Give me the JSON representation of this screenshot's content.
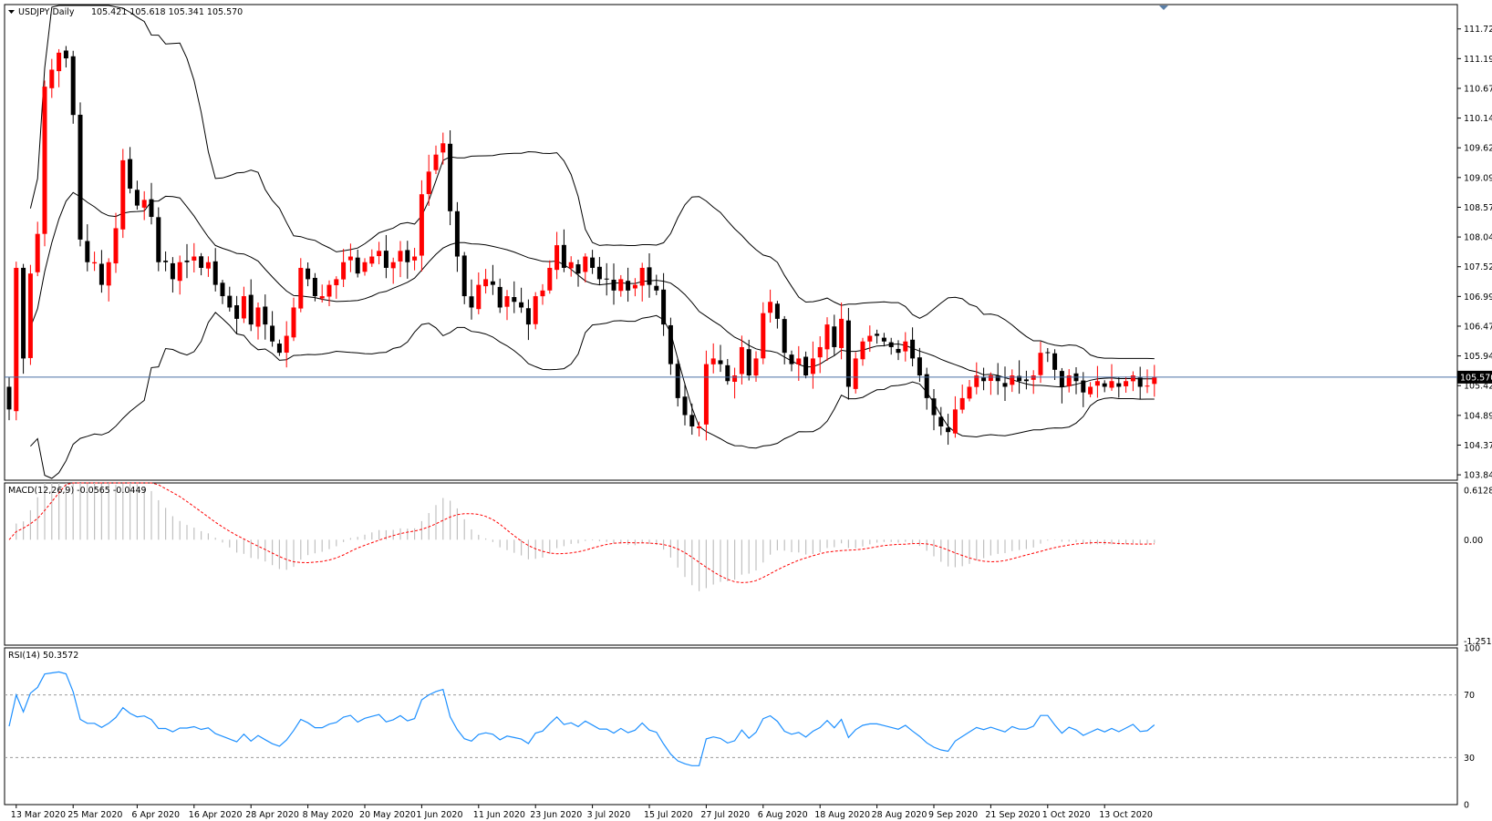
{
  "chart_data": [
    {
      "type": "candlestick",
      "panel": "main",
      "symbol": "USDJPY,Daily",
      "ohlc_header": "105.421 105.618 105.341 105.570",
      "y_ticks": [
        "111.720",
        "111.195",
        "110.670",
        "110.145",
        "109.620",
        "109.095",
        "108.570",
        "108.045",
        "107.520",
        "106.995",
        "106.470",
        "105.945",
        "105.420",
        "104.895",
        "104.370",
        "103.845"
      ],
      "ylim": [
        103.75,
        112.15
      ],
      "current_price": "105.570",
      "current_price_value": 105.57,
      "indicator": "Bollinger Bands (20,2)",
      "x_tick_labels": [
        "13 Mar 2020",
        "25 Mar 2020",
        "6 Apr 2020",
        "16 Apr 2020",
        "28 Apr 2020",
        "8 May 2020",
        "20 May 2020",
        "1 Jun 2020",
        "11 Jun 2020",
        "23 Jun 2020",
        "3 Jul 2020",
        "15 Jul 2020",
        "27 Jul 2020",
        "6 Aug 2020",
        "18 Aug 2020",
        "28 Aug 2020",
        "9 Sep 2020",
        "21 Sep 2020",
        "1 Oct 2020",
        "13 Oct 2020"
      ],
      "x_tick_index": [
        1,
        9,
        18,
        26,
        34,
        42,
        50,
        58,
        66,
        74,
        82,
        90,
        98,
        106,
        114,
        122,
        130,
        138,
        146,
        154
      ],
      "bar_count": 162,
      "close_anchors": [
        [
          0,
          105.0
        ],
        [
          1,
          107.5
        ],
        [
          2,
          105.9
        ],
        [
          3,
          107.4
        ],
        [
          4,
          108.1
        ],
        [
          5,
          110.7
        ],
        [
          6,
          111.0
        ],
        [
          7,
          111.3
        ],
        [
          8,
          111.2
        ],
        [
          9,
          110.2
        ],
        [
          10,
          108.0
        ],
        [
          11,
          107.6
        ],
        [
          12,
          107.6
        ],
        [
          13,
          107.2
        ],
        [
          14,
          107.6
        ],
        [
          15,
          108.2
        ],
        [
          16,
          109.4
        ],
        [
          17,
          108.9
        ],
        [
          18,
          108.6
        ],
        [
          19,
          108.7
        ],
        [
          20,
          108.4
        ],
        [
          21,
          107.6
        ],
        [
          22,
          107.6
        ],
        [
          23,
          107.3
        ],
        [
          24,
          107.6
        ],
        [
          25,
          107.6
        ],
        [
          26,
          107.7
        ],
        [
          27,
          107.5
        ],
        [
          28,
          107.6
        ],
        [
          29,
          107.2
        ],
        [
          30,
          107.0
        ],
        [
          31,
          106.8
        ],
        [
          32,
          106.6
        ],
        [
          33,
          107.0
        ],
        [
          34,
          106.5
        ],
        [
          35,
          106.8
        ],
        [
          36,
          106.5
        ],
        [
          37,
          106.2
        ],
        [
          38,
          106.0
        ],
        [
          39,
          106.3
        ],
        [
          40,
          106.8
        ],
        [
          41,
          107.5
        ],
        [
          42,
          107.3
        ],
        [
          43,
          107.0
        ],
        [
          44,
          107.0
        ],
        [
          45,
          107.2
        ],
        [
          46,
          107.3
        ],
        [
          47,
          107.6
        ],
        [
          48,
          107.7
        ],
        [
          49,
          107.4
        ],
        [
          50,
          107.6
        ],
        [
          51,
          107.7
        ],
        [
          52,
          107.8
        ],
        [
          53,
          107.5
        ],
        [
          54,
          107.6
        ],
        [
          55,
          107.8
        ],
        [
          56,
          107.6
        ],
        [
          57,
          107.7
        ],
        [
          58,
          108.8
        ],
        [
          59,
          109.2
        ],
        [
          60,
          109.5
        ],
        [
          61,
          109.7
        ],
        [
          62,
          108.5
        ],
        [
          63,
          107.7
        ],
        [
          64,
          107.0
        ],
        [
          65,
          106.8
        ],
        [
          66,
          107.2
        ],
        [
          67,
          107.3
        ],
        [
          68,
          107.2
        ],
        [
          69,
          106.8
        ],
        [
          70,
          107.0
        ],
        [
          71,
          106.9
        ],
        [
          72,
          106.8
        ],
        [
          73,
          106.5
        ],
        [
          74,
          107.0
        ],
        [
          75,
          107.1
        ],
        [
          76,
          107.5
        ],
        [
          77,
          107.9
        ],
        [
          78,
          107.5
        ],
        [
          79,
          107.6
        ],
        [
          80,
          107.4
        ],
        [
          81,
          107.7
        ],
        [
          82,
          107.5
        ],
        [
          83,
          107.3
        ],
        [
          84,
          107.3
        ],
        [
          85,
          107.1
        ],
        [
          86,
          107.3
        ],
        [
          87,
          107.1
        ],
        [
          88,
          107.2
        ],
        [
          89,
          107.5
        ],
        [
          90,
          107.2
        ],
        [
          91,
          107.1
        ],
        [
          92,
          106.5
        ],
        [
          93,
          105.8
        ],
        [
          94,
          105.2
        ],
        [
          95,
          104.9
        ],
        [
          96,
          104.7
        ],
        [
          97,
          104.7
        ],
        [
          98,
          105.8
        ],
        [
          99,
          105.9
        ],
        [
          100,
          105.8
        ],
        [
          101,
          105.5
        ],
        [
          102,
          105.6
        ],
        [
          103,
          106.1
        ],
        [
          104,
          105.6
        ],
        [
          105,
          105.9
        ],
        [
          106,
          106.7
        ],
        [
          107,
          106.9
        ],
        [
          108,
          106.6
        ],
        [
          109,
          106.0
        ],
        [
          110,
          105.8
        ],
        [
          111,
          105.9
        ],
        [
          112,
          105.6
        ],
        [
          113,
          105.9
        ],
        [
          114,
          106.1
        ],
        [
          115,
          106.5
        ],
        [
          116,
          106.1
        ],
        [
          117,
          106.6
        ],
        [
          118,
          105.4
        ],
        [
          119,
          105.9
        ],
        [
          120,
          106.2
        ],
        [
          121,
          106.3
        ],
        [
          122,
          106.3
        ],
        [
          123,
          106.2
        ],
        [
          124,
          106.1
        ],
        [
          125,
          106.0
        ],
        [
          126,
          106.2
        ],
        [
          127,
          105.9
        ],
        [
          128,
          105.6
        ],
        [
          129,
          105.2
        ],
        [
          130,
          104.9
        ],
        [
          131,
          104.7
        ],
        [
          132,
          104.6
        ],
        [
          133,
          105.0
        ],
        [
          134,
          105.2
        ],
        [
          135,
          105.4
        ],
        [
          136,
          105.6
        ],
        [
          137,
          105.5
        ],
        [
          138,
          105.6
        ],
        [
          139,
          105.5
        ],
        [
          140,
          105.4
        ],
        [
          141,
          105.6
        ],
        [
          142,
          105.5
        ],
        [
          143,
          105.5
        ],
        [
          144,
          105.6
        ],
        [
          145,
          106.0
        ],
        [
          146,
          106.0
        ],
        [
          147,
          105.7
        ],
        [
          148,
          105.4
        ],
        [
          149,
          105.6
        ],
        [
          150,
          105.5
        ],
        [
          151,
          105.3
        ],
        [
          152,
          105.4
        ],
        [
          153,
          105.5
        ],
        [
          154,
          105.4
        ],
        [
          155,
          105.5
        ],
        [
          156,
          105.4
        ],
        [
          157,
          105.5
        ],
        [
          158,
          105.6
        ],
        [
          159,
          105.4
        ],
        [
          160,
          105.42
        ],
        [
          161,
          105.57
        ]
      ]
    },
    {
      "type": "histogram",
      "panel": "macd",
      "label": "MACD(12,26,9) -0.0565 -0.0449",
      "y_ticks": [
        "0.6128",
        "0.00",
        "-1.2515"
      ],
      "ylim": [
        -1.3,
        0.7
      ],
      "signal_line": "dashed red",
      "histogram_color": "#c0c0c0"
    },
    {
      "type": "line",
      "panel": "rsi",
      "label": "RSI(14) 50.3572",
      "y_ticks": [
        "100",
        "70",
        "30",
        "0"
      ],
      "ylim": [
        0,
        100
      ],
      "levels": [
        70,
        30
      ],
      "line_color": "#1e90ff"
    }
  ],
  "colors": {
    "bull": "#ff0000",
    "bear": "#000000",
    "bands": "#000000",
    "macd_signal": "#ff0000",
    "rsi": "#1e90ff",
    "price_line": "#4a6fa5"
  }
}
